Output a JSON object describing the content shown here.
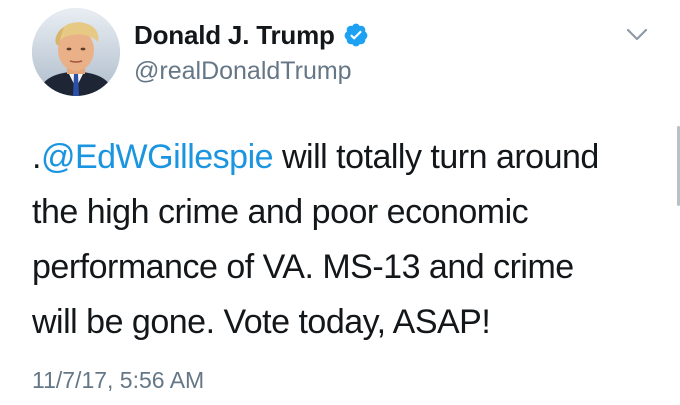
{
  "tweet": {
    "author": {
      "display_name": "Donald J. Trump",
      "handle": "@realDonaldTrump",
      "verified": true,
      "avatar_icon": "profile-photo"
    },
    "text": {
      "prefix": ".",
      "mention": "@EdWGillespie",
      "line1_rest": " will totally turn around",
      "line2": "the high crime and poor economic",
      "line3": "performance of VA. MS-13 and crime",
      "line4": "will be gone. Vote today, ASAP!"
    },
    "timestamp": "11/7/17, 5:56 AM",
    "menu_icon": "chevron-down-icon"
  },
  "colors": {
    "text": "#14171a",
    "secondary": "#657786",
    "link": "#1b95e0",
    "verified_badge": "#1da1f2",
    "background": "#ffffff"
  }
}
